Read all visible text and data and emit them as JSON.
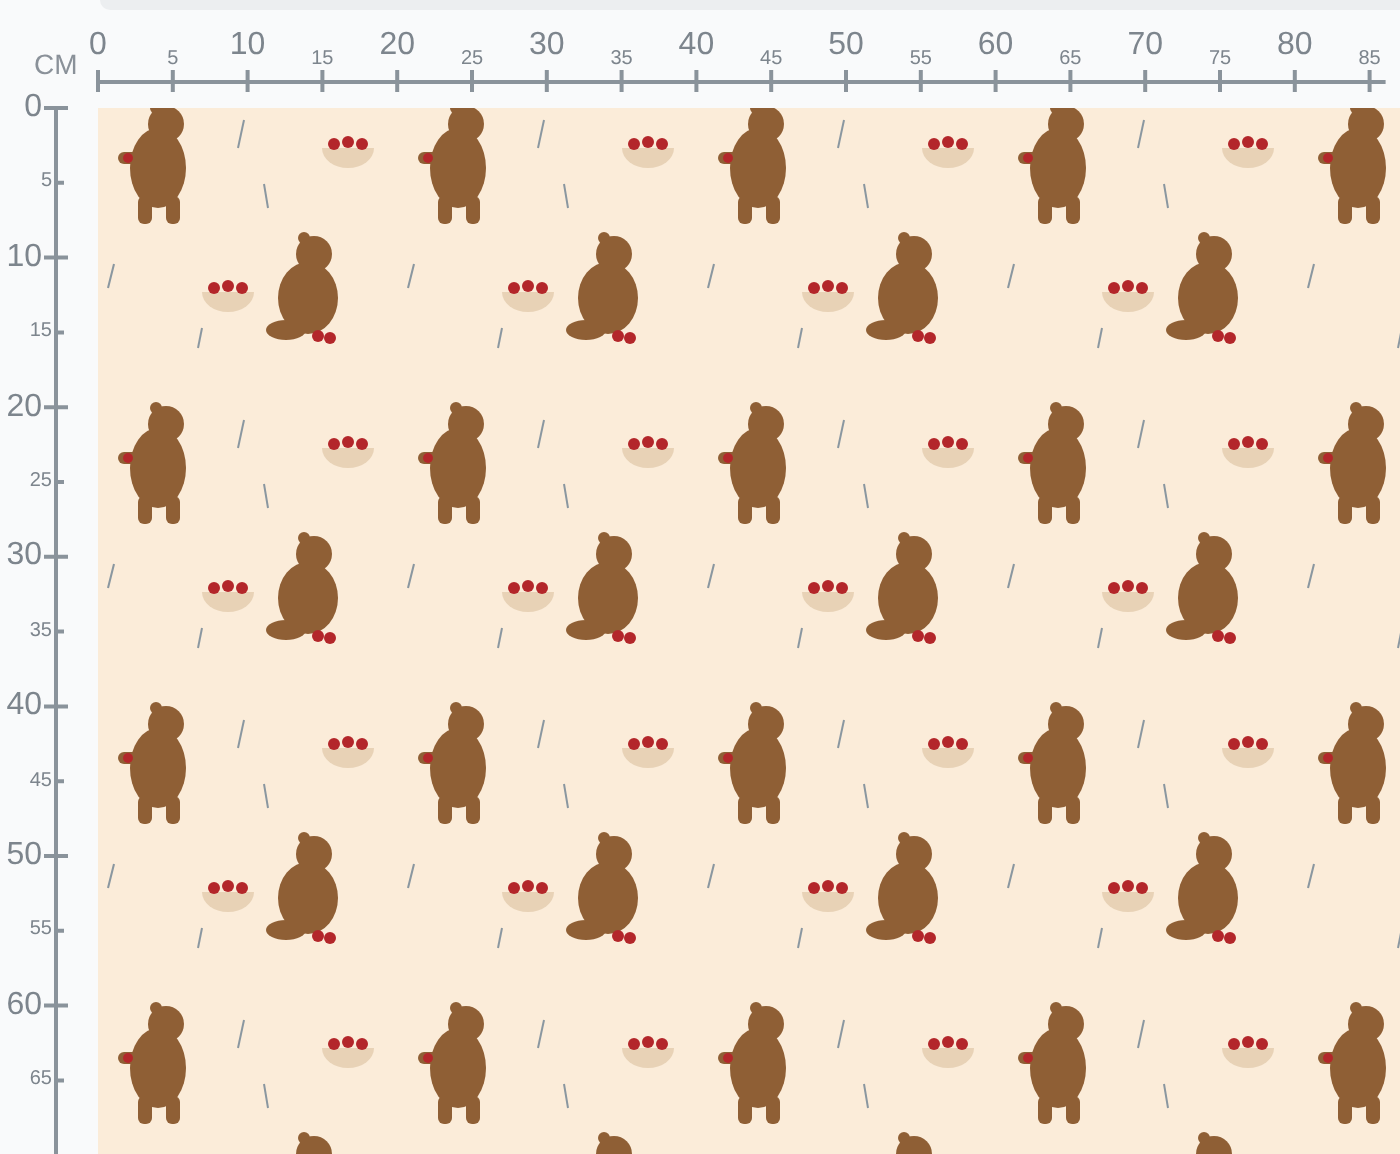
{
  "unit": "CM",
  "top_ruler": {
    "labels": [
      "0",
      "5",
      "10",
      "15",
      "20",
      "25",
      "30",
      "35",
      "40",
      "45",
      "50",
      "55",
      "60",
      "65",
      "70",
      "75",
      "80",
      "85"
    ]
  },
  "left_ruler": {
    "labels": [
      "0",
      "5",
      "10",
      "15",
      "20",
      "25",
      "30",
      "35",
      "40",
      "45",
      "50",
      "55",
      "60",
      "65"
    ]
  }
}
